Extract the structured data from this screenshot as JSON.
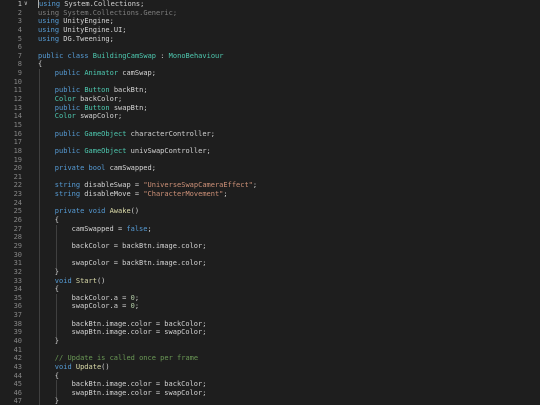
{
  "editor": {
    "language": "C#",
    "colors": {
      "background": "#1e1e1e",
      "keyword": "#569cd6",
      "type": "#4ec9b0",
      "function": "#dcdcaa",
      "string": "#ce9178",
      "number": "#b5cea8",
      "comment": "#6a9955",
      "identifier": "#d4d4d4",
      "line_number": "#858585"
    },
    "fold_icon": "chevron-down-icon",
    "lines": [
      {
        "num": "1",
        "indent": 0,
        "tokens": [
          {
            "t": "kw",
            "v": "using"
          },
          {
            "t": "id",
            "v": " System.Collections;"
          }
        ]
      },
      {
        "num": "2",
        "indent": 0,
        "tokens": [
          {
            "t": "dim",
            "v": "using System.Collections.Generic;"
          }
        ]
      },
      {
        "num": "3",
        "indent": 0,
        "tokens": [
          {
            "t": "kw",
            "v": "using"
          },
          {
            "t": "id",
            "v": " UnityEngine;"
          }
        ]
      },
      {
        "num": "4",
        "indent": 0,
        "tokens": [
          {
            "t": "kw",
            "v": "using"
          },
          {
            "t": "id",
            "v": " UnityEngine.UI;"
          }
        ]
      },
      {
        "num": "5",
        "indent": 0,
        "tokens": [
          {
            "t": "kw",
            "v": "using"
          },
          {
            "t": "id",
            "v": " DG.Tweening;"
          }
        ]
      },
      {
        "num": "6",
        "indent": 0,
        "tokens": []
      },
      {
        "num": "7",
        "indent": 0,
        "tokens": [
          {
            "t": "kw",
            "v": "public class "
          },
          {
            "t": "ty",
            "v": "BuildingCamSwap"
          },
          {
            "t": "id",
            "v": " : "
          },
          {
            "t": "ty",
            "v": "MonoBehaviour"
          }
        ]
      },
      {
        "num": "8",
        "indent": 0,
        "tokens": [
          {
            "t": "id",
            "v": "{"
          }
        ]
      },
      {
        "num": "9",
        "indent": 1,
        "tokens": [
          {
            "t": "kw",
            "v": "public "
          },
          {
            "t": "ty",
            "v": "Animator"
          },
          {
            "t": "id",
            "v": " camSwap;"
          }
        ]
      },
      {
        "num": "10",
        "indent": 1,
        "tokens": []
      },
      {
        "num": "11",
        "indent": 1,
        "tokens": [
          {
            "t": "kw",
            "v": "public "
          },
          {
            "t": "ty",
            "v": "Button"
          },
          {
            "t": "id",
            "v": " backBtn;"
          }
        ]
      },
      {
        "num": "12",
        "indent": 1,
        "tokens": [
          {
            "t": "ty",
            "v": "Color"
          },
          {
            "t": "id",
            "v": " backColor;"
          }
        ]
      },
      {
        "num": "13",
        "indent": 1,
        "tokens": [
          {
            "t": "kw",
            "v": "public "
          },
          {
            "t": "ty",
            "v": "Button"
          },
          {
            "t": "id",
            "v": " swapBtn;"
          }
        ]
      },
      {
        "num": "14",
        "indent": 1,
        "tokens": [
          {
            "t": "ty",
            "v": "Color"
          },
          {
            "t": "id",
            "v": " swapColor;"
          }
        ]
      },
      {
        "num": "15",
        "indent": 1,
        "tokens": []
      },
      {
        "num": "16",
        "indent": 1,
        "tokens": [
          {
            "t": "kw",
            "v": "public "
          },
          {
            "t": "ty",
            "v": "GameObject"
          },
          {
            "t": "id",
            "v": " characterController;"
          }
        ]
      },
      {
        "num": "17",
        "indent": 1,
        "tokens": []
      },
      {
        "num": "18",
        "indent": 1,
        "tokens": [
          {
            "t": "kw",
            "v": "public "
          },
          {
            "t": "ty",
            "v": "GameObject"
          },
          {
            "t": "id",
            "v": " univSwapController;"
          }
        ]
      },
      {
        "num": "19",
        "indent": 1,
        "tokens": []
      },
      {
        "num": "20",
        "indent": 1,
        "tokens": [
          {
            "t": "kw",
            "v": "private bool"
          },
          {
            "t": "id",
            "v": " camSwapped;"
          }
        ]
      },
      {
        "num": "21",
        "indent": 1,
        "tokens": []
      },
      {
        "num": "22",
        "indent": 1,
        "tokens": [
          {
            "t": "kw",
            "v": "string"
          },
          {
            "t": "id",
            "v": " disableSwap = "
          },
          {
            "t": "str",
            "v": "\"UniverseSwapCameraEffect\""
          },
          {
            "t": "id",
            "v": ";"
          }
        ]
      },
      {
        "num": "23",
        "indent": 1,
        "tokens": [
          {
            "t": "kw",
            "v": "string"
          },
          {
            "t": "id",
            "v": " disableMove = "
          },
          {
            "t": "str",
            "v": "\"CharacterMovement\""
          },
          {
            "t": "id",
            "v": ";"
          }
        ]
      },
      {
        "num": "24",
        "indent": 1,
        "tokens": []
      },
      {
        "num": "25",
        "indent": 1,
        "tokens": [
          {
            "t": "kw",
            "v": "private void "
          },
          {
            "t": "fn",
            "v": "Awake"
          },
          {
            "t": "id",
            "v": "()"
          }
        ]
      },
      {
        "num": "26",
        "indent": 1,
        "tokens": [
          {
            "t": "id",
            "v": "{"
          }
        ]
      },
      {
        "num": "27",
        "indent": 2,
        "tokens": [
          {
            "t": "id",
            "v": "camSwapped = "
          },
          {
            "t": "kw",
            "v": "false"
          },
          {
            "t": "id",
            "v": ";"
          }
        ]
      },
      {
        "num": "28",
        "indent": 2,
        "tokens": []
      },
      {
        "num": "29",
        "indent": 2,
        "tokens": [
          {
            "t": "id",
            "v": "backColor = backBtn.image.color;"
          }
        ]
      },
      {
        "num": "30",
        "indent": 2,
        "tokens": []
      },
      {
        "num": "31",
        "indent": 2,
        "tokens": [
          {
            "t": "id",
            "v": "swapColor = backBtn.image.color;"
          }
        ]
      },
      {
        "num": "32",
        "indent": 1,
        "tokens": [
          {
            "t": "id",
            "v": "}"
          }
        ]
      },
      {
        "num": "33",
        "indent": 1,
        "tokens": [
          {
            "t": "kw",
            "v": "void "
          },
          {
            "t": "fn",
            "v": "Start"
          },
          {
            "t": "id",
            "v": "()"
          }
        ]
      },
      {
        "num": "34",
        "indent": 1,
        "tokens": [
          {
            "t": "id",
            "v": "{"
          }
        ]
      },
      {
        "num": "35",
        "indent": 2,
        "tokens": [
          {
            "t": "id",
            "v": "backColor.a = "
          },
          {
            "t": "num",
            "v": "0"
          },
          {
            "t": "id",
            "v": ";"
          }
        ]
      },
      {
        "num": "36",
        "indent": 2,
        "tokens": [
          {
            "t": "id",
            "v": "swapColor.a = "
          },
          {
            "t": "num",
            "v": "0"
          },
          {
            "t": "id",
            "v": ";"
          }
        ]
      },
      {
        "num": "37",
        "indent": 2,
        "tokens": []
      },
      {
        "num": "38",
        "indent": 2,
        "tokens": [
          {
            "t": "id",
            "v": "backBtn.image.color = backColor;"
          }
        ]
      },
      {
        "num": "39",
        "indent": 2,
        "tokens": [
          {
            "t": "id",
            "v": "swapBtn.image.color = swapColor;"
          }
        ]
      },
      {
        "num": "40",
        "indent": 1,
        "tokens": [
          {
            "t": "id",
            "v": "}"
          }
        ]
      },
      {
        "num": "41",
        "indent": 1,
        "tokens": []
      },
      {
        "num": "42",
        "indent": 1,
        "tokens": [
          {
            "t": "com",
            "v": "// Update is called once per frame"
          }
        ]
      },
      {
        "num": "43",
        "indent": 1,
        "tokens": [
          {
            "t": "kw",
            "v": "void "
          },
          {
            "t": "fn",
            "v": "Update"
          },
          {
            "t": "id",
            "v": "()"
          }
        ]
      },
      {
        "num": "44",
        "indent": 1,
        "tokens": [
          {
            "t": "id",
            "v": "{"
          }
        ]
      },
      {
        "num": "45",
        "indent": 2,
        "tokens": [
          {
            "t": "id",
            "v": "backBtn.image.color = backColor;"
          }
        ]
      },
      {
        "num": "46",
        "indent": 2,
        "tokens": [
          {
            "t": "id",
            "v": "swapBtn.image.color = swapColor;"
          }
        ]
      },
      {
        "num": "47",
        "indent": 1,
        "tokens": [
          {
            "t": "id",
            "v": "}"
          }
        ]
      },
      {
        "num": "48",
        "indent": 1,
        "tokens": []
      }
    ]
  }
}
